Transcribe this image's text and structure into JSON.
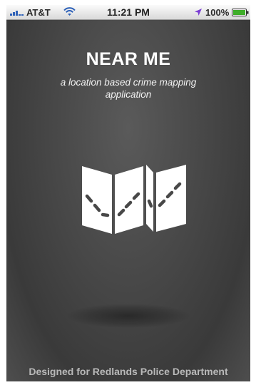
{
  "status_bar": {
    "carrier": "AT&T",
    "time": "11:21 PM",
    "battery_percent": "100%",
    "signal_icon": "signal-bars-icon",
    "wifi_icon": "wifi-icon",
    "location_icon": "location-arrow-icon",
    "battery_icon": "battery-icon",
    "location_color": "#7b3fd4",
    "battery_fill_color": "#3fae2a"
  },
  "splash": {
    "title": "NEAR ME",
    "subtitle": "a location based crime mapping application",
    "logo_icon": "folded-map-icon",
    "footer": "Designed for Redlands Police Department"
  }
}
